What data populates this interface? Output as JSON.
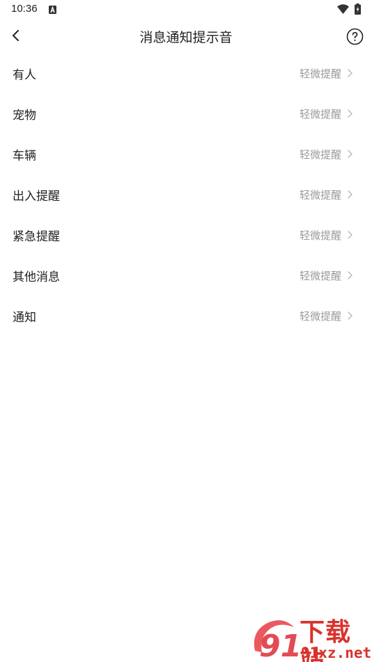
{
  "status_bar": {
    "time": "10:36"
  },
  "header": {
    "title": "消息通知提示音"
  },
  "items": [
    {
      "label": "有人",
      "value": "轻微提醒"
    },
    {
      "label": "宠物",
      "value": "轻微提醒"
    },
    {
      "label": "车辆",
      "value": "轻微提醒"
    },
    {
      "label": "出入提醒",
      "value": "轻微提醒"
    },
    {
      "label": "紧急提醒",
      "value": "轻微提醒"
    },
    {
      "label": "其他消息",
      "value": "轻微提醒"
    },
    {
      "label": "通知",
      "value": "轻微提醒"
    }
  ],
  "watermark": {
    "site_name": "下载站",
    "domain": "91xz.net",
    "logo_text": "91"
  },
  "colors": {
    "text": "#222222",
    "secondary_text": "#9a9a9a",
    "chevron": "#bbbbbb",
    "watermark": "#d8332c"
  }
}
